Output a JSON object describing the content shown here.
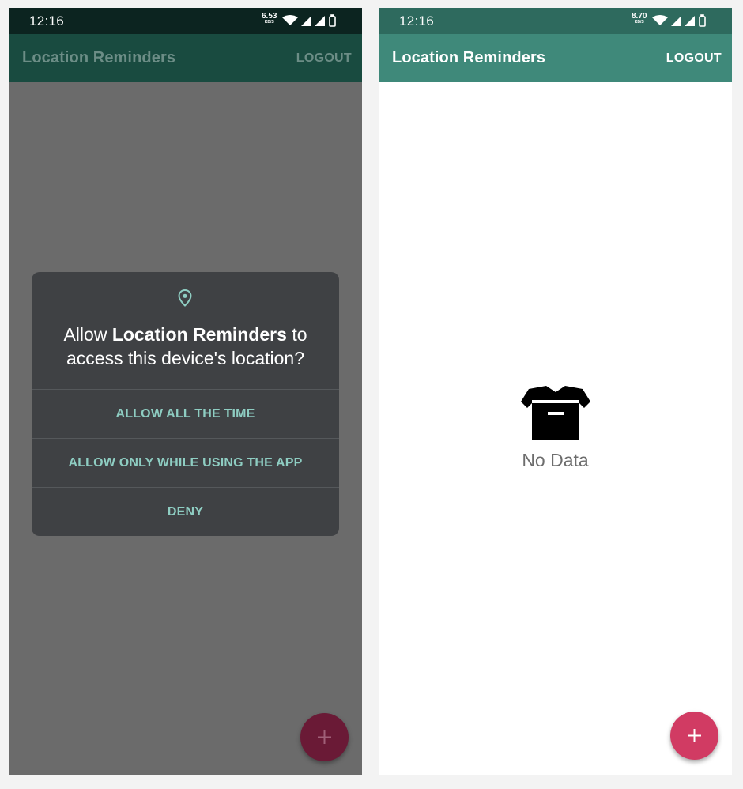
{
  "left_screen": {
    "status": {
      "time": "12:16",
      "speed_value": "6.53",
      "speed_unit": "KB/S"
    },
    "appbar": {
      "title": "Location Reminders",
      "logout_label": "LOGOUT"
    },
    "dialog": {
      "message_prefix": "Allow ",
      "app_name": "Location Reminders",
      "message_suffix_line1": " to",
      "message_line2": "access this device's location?",
      "options": [
        {
          "label": "ALLOW ALL THE TIME"
        },
        {
          "label": "ALLOW ONLY WHILE USING THE APP"
        },
        {
          "label": "DENY"
        }
      ],
      "icon": "location-pin-icon"
    },
    "fab_icon": "plus-icon"
  },
  "right_screen": {
    "status": {
      "time": "12:16",
      "speed_value": "8.70",
      "speed_unit": "KB/S"
    },
    "appbar": {
      "title": "Location Reminders",
      "logout_label": "LOGOUT"
    },
    "empty_state": {
      "label": "No Data",
      "icon": "archive-box-icon"
    },
    "fab_icon": "plus-icon"
  },
  "colors": {
    "primary": "#3f897a",
    "primary_dark": "#2e6a5e",
    "accent": "#d13b63",
    "dialog_background": "#3f4144",
    "dialog_option_text": "#8ecdc2"
  }
}
